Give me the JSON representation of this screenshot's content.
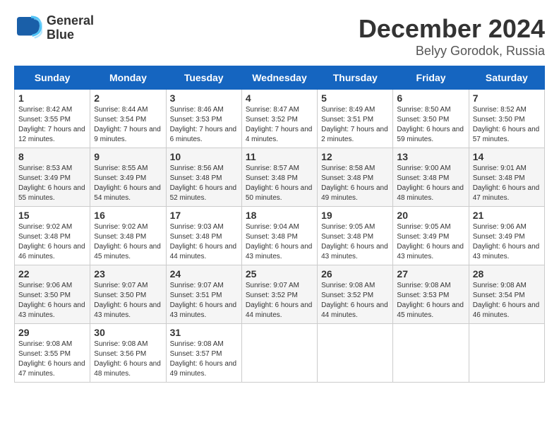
{
  "header": {
    "logo_line1": "General",
    "logo_line2": "Blue",
    "month": "December 2024",
    "location": "Belyy Gorodok, Russia"
  },
  "weekdays": [
    "Sunday",
    "Monday",
    "Tuesday",
    "Wednesday",
    "Thursday",
    "Friday",
    "Saturday"
  ],
  "weeks": [
    [
      {
        "day": "1",
        "sunrise": "Sunrise: 8:42 AM",
        "sunset": "Sunset: 3:55 PM",
        "daylight": "Daylight: 7 hours and 12 minutes."
      },
      {
        "day": "2",
        "sunrise": "Sunrise: 8:44 AM",
        "sunset": "Sunset: 3:54 PM",
        "daylight": "Daylight: 7 hours and 9 minutes."
      },
      {
        "day": "3",
        "sunrise": "Sunrise: 8:46 AM",
        "sunset": "Sunset: 3:53 PM",
        "daylight": "Daylight: 7 hours and 6 minutes."
      },
      {
        "day": "4",
        "sunrise": "Sunrise: 8:47 AM",
        "sunset": "Sunset: 3:52 PM",
        "daylight": "Daylight: 7 hours and 4 minutes."
      },
      {
        "day": "5",
        "sunrise": "Sunrise: 8:49 AM",
        "sunset": "Sunset: 3:51 PM",
        "daylight": "Daylight: 7 hours and 2 minutes."
      },
      {
        "day": "6",
        "sunrise": "Sunrise: 8:50 AM",
        "sunset": "Sunset: 3:50 PM",
        "daylight": "Daylight: 6 hours and 59 minutes."
      },
      {
        "day": "7",
        "sunrise": "Sunrise: 8:52 AM",
        "sunset": "Sunset: 3:50 PM",
        "daylight": "Daylight: 6 hours and 57 minutes."
      }
    ],
    [
      {
        "day": "8",
        "sunrise": "Sunrise: 8:53 AM",
        "sunset": "Sunset: 3:49 PM",
        "daylight": "Daylight: 6 hours and 55 minutes."
      },
      {
        "day": "9",
        "sunrise": "Sunrise: 8:55 AM",
        "sunset": "Sunset: 3:49 PM",
        "daylight": "Daylight: 6 hours and 54 minutes."
      },
      {
        "day": "10",
        "sunrise": "Sunrise: 8:56 AM",
        "sunset": "Sunset: 3:48 PM",
        "daylight": "Daylight: 6 hours and 52 minutes."
      },
      {
        "day": "11",
        "sunrise": "Sunrise: 8:57 AM",
        "sunset": "Sunset: 3:48 PM",
        "daylight": "Daylight: 6 hours and 50 minutes."
      },
      {
        "day": "12",
        "sunrise": "Sunrise: 8:58 AM",
        "sunset": "Sunset: 3:48 PM",
        "daylight": "Daylight: 6 hours and 49 minutes."
      },
      {
        "day": "13",
        "sunrise": "Sunrise: 9:00 AM",
        "sunset": "Sunset: 3:48 PM",
        "daylight": "Daylight: 6 hours and 48 minutes."
      },
      {
        "day": "14",
        "sunrise": "Sunrise: 9:01 AM",
        "sunset": "Sunset: 3:48 PM",
        "daylight": "Daylight: 6 hours and 47 minutes."
      }
    ],
    [
      {
        "day": "15",
        "sunrise": "Sunrise: 9:02 AM",
        "sunset": "Sunset: 3:48 PM",
        "daylight": "Daylight: 6 hours and 46 minutes."
      },
      {
        "day": "16",
        "sunrise": "Sunrise: 9:02 AM",
        "sunset": "Sunset: 3:48 PM",
        "daylight": "Daylight: 6 hours and 45 minutes."
      },
      {
        "day": "17",
        "sunrise": "Sunrise: 9:03 AM",
        "sunset": "Sunset: 3:48 PM",
        "daylight": "Daylight: 6 hours and 44 minutes."
      },
      {
        "day": "18",
        "sunrise": "Sunrise: 9:04 AM",
        "sunset": "Sunset: 3:48 PM",
        "daylight": "Daylight: 6 hours and 43 minutes."
      },
      {
        "day": "19",
        "sunrise": "Sunrise: 9:05 AM",
        "sunset": "Sunset: 3:48 PM",
        "daylight": "Daylight: 6 hours and 43 minutes."
      },
      {
        "day": "20",
        "sunrise": "Sunrise: 9:05 AM",
        "sunset": "Sunset: 3:49 PM",
        "daylight": "Daylight: 6 hours and 43 minutes."
      },
      {
        "day": "21",
        "sunrise": "Sunrise: 9:06 AM",
        "sunset": "Sunset: 3:49 PM",
        "daylight": "Daylight: 6 hours and 43 minutes."
      }
    ],
    [
      {
        "day": "22",
        "sunrise": "Sunrise: 9:06 AM",
        "sunset": "Sunset: 3:50 PM",
        "daylight": "Daylight: 6 hours and 43 minutes."
      },
      {
        "day": "23",
        "sunrise": "Sunrise: 9:07 AM",
        "sunset": "Sunset: 3:50 PM",
        "daylight": "Daylight: 6 hours and 43 minutes."
      },
      {
        "day": "24",
        "sunrise": "Sunrise: 9:07 AM",
        "sunset": "Sunset: 3:51 PM",
        "daylight": "Daylight: 6 hours and 43 minutes."
      },
      {
        "day": "25",
        "sunrise": "Sunrise: 9:07 AM",
        "sunset": "Sunset: 3:52 PM",
        "daylight": "Daylight: 6 hours and 44 minutes."
      },
      {
        "day": "26",
        "sunrise": "Sunrise: 9:08 AM",
        "sunset": "Sunset: 3:52 PM",
        "daylight": "Daylight: 6 hours and 44 minutes."
      },
      {
        "day": "27",
        "sunrise": "Sunrise: 9:08 AM",
        "sunset": "Sunset: 3:53 PM",
        "daylight": "Daylight: 6 hours and 45 minutes."
      },
      {
        "day": "28",
        "sunrise": "Sunrise: 9:08 AM",
        "sunset": "Sunset: 3:54 PM",
        "daylight": "Daylight: 6 hours and 46 minutes."
      }
    ],
    [
      {
        "day": "29",
        "sunrise": "Sunrise: 9:08 AM",
        "sunset": "Sunset: 3:55 PM",
        "daylight": "Daylight: 6 hours and 47 minutes."
      },
      {
        "day": "30",
        "sunrise": "Sunrise: 9:08 AM",
        "sunset": "Sunset: 3:56 PM",
        "daylight": "Daylight: 6 hours and 48 minutes."
      },
      {
        "day": "31",
        "sunrise": "Sunrise: 9:08 AM",
        "sunset": "Sunset: 3:57 PM",
        "daylight": "Daylight: 6 hours and 49 minutes."
      },
      null,
      null,
      null,
      null
    ]
  ]
}
